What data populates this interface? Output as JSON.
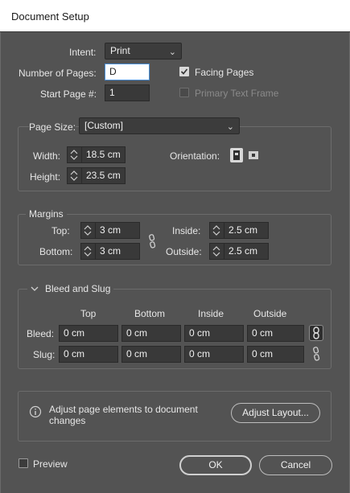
{
  "window": {
    "title": "Document Setup"
  },
  "intent": {
    "label": "Intent:",
    "value": "Print"
  },
  "pages": {
    "number_label": "Number of Pages:",
    "number_value": "D",
    "start_label": "Start Page #:",
    "start_value": "1"
  },
  "facing_pages": {
    "label": "Facing Pages",
    "checked": true
  },
  "primary_text_frame": {
    "label": "Primary Text Frame",
    "checked": false,
    "enabled": false
  },
  "page_size": {
    "label": "Page Size:",
    "value": "[Custom]",
    "width_label": "Width:",
    "width_value": "18.5 cm",
    "height_label": "Height:",
    "height_value": "23.5 cm",
    "orientation_label": "Orientation:"
  },
  "margins": {
    "title": "Margins",
    "top_label": "Top:",
    "top_value": "3 cm",
    "bottom_label": "Bottom:",
    "bottom_value": "3 cm",
    "inside_label": "Inside:",
    "inside_value": "2.5 cm",
    "outside_label": "Outside:",
    "outside_value": "2.5 cm"
  },
  "bleed_slug": {
    "title": "Bleed and Slug",
    "headers": [
      "Top",
      "Bottom",
      "Inside",
      "Outside"
    ],
    "bleed_label": "Bleed:",
    "bleed_values": [
      "0 cm",
      "0 cm",
      "0 cm",
      "0 cm"
    ],
    "slug_label": "Slug:",
    "slug_values": [
      "0 cm",
      "0 cm",
      "0 cm",
      "0 cm"
    ]
  },
  "adjust": {
    "message": "Adjust page elements to document changes",
    "button": "Adjust Layout..."
  },
  "preview": {
    "label": "Preview",
    "checked": false
  },
  "buttons": {
    "ok": "OK",
    "cancel": "Cancel"
  },
  "icons": {
    "dropdown": "chevron-down-icon",
    "stepper": "stepper-icon",
    "portrait": "portrait-orientation-icon",
    "landscape": "landscape-orientation-icon",
    "link": "chain-link-icon",
    "unlink": "broken-link-icon",
    "info": "info-icon",
    "collapse": "chevron-collapse-icon",
    "check": "checkmark-icon"
  }
}
